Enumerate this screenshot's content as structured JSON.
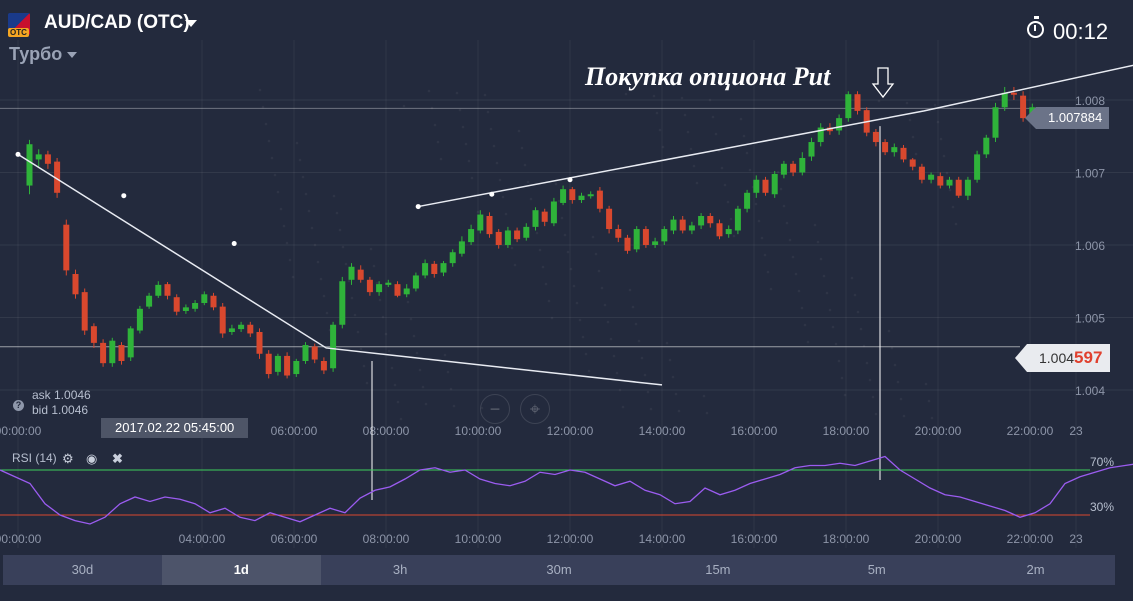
{
  "header": {
    "pair": "AUD/CAD (OTC)",
    "flag_badge": "OTC",
    "mode": "Турбо",
    "timer": "00:12"
  },
  "annotation": "Покупка опциона Put",
  "price_labels": {
    "current": "1.007884",
    "strike_prefix": "1.004",
    "strike_suffix": "597"
  },
  "quotes": {
    "ask": "ask 1.0046",
    "bid": "bid 1.0046",
    "help_icon": "?"
  },
  "crosshair_date": "2017.02.22 05:45:00",
  "rsi": {
    "label": "RSI (14)",
    "upper": "70%",
    "lower": "30%",
    "upper_level": 70,
    "lower_level": 30
  },
  "timeframes": [
    "30d",
    "1d",
    "3h",
    "30m",
    "15m",
    "5m",
    "2m"
  ],
  "active_timeframe": "1d",
  "colors": {
    "bg": "#232a3d",
    "up": "#2fb33a",
    "down": "#d9482e",
    "rsi_line": "#9b5cf0",
    "level70": "#3ccf5a",
    "level30": "#d9482e"
  },
  "chart_data": {
    "type": "candlestick",
    "y_ticks": [
      "1.008",
      "1.007",
      "1.006",
      "1.005",
      "1.004"
    ],
    "y_tick_values": [
      1.008,
      1.007,
      1.006,
      1.005,
      1.004
    ],
    "ylim": [
      1.00325,
      1.00855
    ],
    "x_ticks": [
      "00:00:00",
      "04:00:00",
      "06:00:00",
      "08:00:00",
      "10:00:00",
      "12:00:00",
      "14:00:00",
      "16:00:00",
      "18:00:00",
      "20:00:00",
      "22:00:00",
      "23"
    ],
    "x_tick_hours": [
      0,
      4,
      6,
      8,
      10,
      12,
      14,
      16,
      18,
      20,
      22,
      23
    ],
    "x_range_hours": [
      0,
      24.4
    ],
    "candles": [
      [
        0.25,
        1.00682,
        1.00739,
        1.0067,
        1.00745
      ],
      [
        0.45,
        1.00718,
        1.00725,
        1.00708,
        1.00732
      ],
      [
        0.65,
        1.00725,
        1.00712,
        1.00705,
        1.0073
      ],
      [
        0.85,
        1.00715,
        1.00672,
        1.00665,
        1.0072
      ],
      [
        1.05,
        1.00628,
        1.00565,
        1.00558,
        1.00635
      ],
      [
        1.25,
        1.0056,
        1.00532,
        1.00526,
        1.00566
      ],
      [
        1.45,
        1.00535,
        1.00482,
        1.00476,
        1.0054
      ],
      [
        1.65,
        1.00488,
        1.00465,
        1.00458,
        1.00492
      ],
      [
        1.85,
        1.00465,
        1.00437,
        1.00432,
        1.0047
      ],
      [
        2.05,
        1.00437,
        1.00468,
        1.00432,
        1.00472
      ],
      [
        2.25,
        1.00462,
        1.0044,
        1.00435,
        1.00466
      ],
      [
        2.45,
        1.00445,
        1.00485,
        1.0044,
        1.00488
      ],
      [
        2.65,
        1.00482,
        1.00512,
        1.00478,
        1.00516
      ],
      [
        2.85,
        1.00515,
        1.0053,
        1.00512,
        1.00534
      ],
      [
        3.05,
        1.0053,
        1.00545,
        1.00527,
        1.0055
      ],
      [
        3.25,
        1.00546,
        1.0053,
        1.00525,
        1.00549
      ],
      [
        3.45,
        1.00528,
        1.00508,
        1.00503,
        1.00532
      ],
      [
        3.65,
        1.00509,
        1.00514,
        1.00505,
        1.00518
      ],
      [
        3.85,
        1.00512,
        1.0052,
        1.00508,
        1.00524
      ],
      [
        4.05,
        1.0052,
        1.00532,
        1.00517,
        1.00536
      ],
      [
        4.25,
        1.0053,
        1.00514,
        1.0051,
        1.00534
      ],
      [
        4.45,
        1.00515,
        1.00478,
        1.00472,
        1.0052
      ],
      [
        4.65,
        1.0048,
        1.00485,
        1.00476,
        1.0049
      ],
      [
        4.85,
        1.00484,
        1.0049,
        1.0048,
        1.00494
      ],
      [
        5.05,
        1.0049,
        1.00478,
        1.00473,
        1.00494
      ],
      [
        5.25,
        1.0048,
        1.0045,
        1.00443,
        1.00485
      ],
      [
        5.45,
        1.0045,
        1.00422,
        1.00416,
        1.00455
      ],
      [
        5.65,
        1.00425,
        1.00447,
        1.0042,
        1.0045
      ],
      [
        5.85,
        1.00447,
        1.0042,
        1.00416,
        1.00452
      ],
      [
        6.05,
        1.00422,
        1.0044,
        1.00418,
        1.00443
      ],
      [
        6.25,
        1.0044,
        1.00462,
        1.00436,
        1.00466
      ],
      [
        6.45,
        1.0046,
        1.00442,
        1.00437,
        1.00464
      ],
      [
        6.65,
        1.0044,
        1.00427,
        1.00422,
        1.00445
      ],
      [
        6.85,
        1.0043,
        1.0049,
        1.00425,
        1.00494
      ],
      [
        7.05,
        1.0049,
        1.0055,
        1.00485,
        1.00556
      ],
      [
        7.25,
        1.00552,
        1.0057,
        1.00545,
        1.00575
      ],
      [
        7.45,
        1.00566,
        1.00552,
        1.00548,
        1.00572
      ],
      [
        7.65,
        1.00552,
        1.00535,
        1.0053,
        1.00556
      ],
      [
        7.85,
        1.00535,
        1.00546,
        1.0053,
        1.0055
      ],
      [
        8.05,
        1.00545,
        1.00548,
        1.00542,
        1.00552
      ],
      [
        8.25,
        1.00546,
        1.0053,
        1.00528,
        1.0055
      ],
      [
        8.45,
        1.00532,
        1.0054,
        1.00528,
        1.00546
      ],
      [
        8.65,
        1.0054,
        1.00558,
        1.00536,
        1.00562
      ],
      [
        8.85,
        1.00558,
        1.00575,
        1.00554,
        1.0058
      ],
      [
        9.05,
        1.00574,
        1.0056,
        1.00555,
        1.00578
      ],
      [
        9.25,
        1.00562,
        1.00575,
        1.00557,
        1.00578
      ],
      [
        9.45,
        1.00575,
        1.0059,
        1.0057,
        1.00594
      ],
      [
        9.65,
        1.00588,
        1.00605,
        1.00584,
        1.00612
      ],
      [
        9.85,
        1.00604,
        1.00622,
        1.006,
        1.00628
      ],
      [
        10.05,
        1.0062,
        1.00642,
        1.00616,
        1.00648
      ],
      [
        10.25,
        1.0064,
        1.00615,
        1.0061,
        1.00645
      ],
      [
        10.45,
        1.00618,
        1.006,
        1.00595,
        1.00622
      ],
      [
        10.65,
        1.006,
        1.0062,
        1.00596,
        1.00625
      ],
      [
        10.85,
        1.0062,
        1.00608,
        1.00604,
        1.00624
      ],
      [
        11.05,
        1.0061,
        1.00625,
        1.00606,
        1.0063
      ],
      [
        11.25,
        1.00625,
        1.00648,
        1.0062,
        1.00652
      ],
      [
        11.45,
        1.00646,
        1.00632,
        1.00626,
        1.0065
      ],
      [
        11.65,
        1.0063,
        1.0066,
        1.00626,
        1.00665
      ],
      [
        11.85,
        1.00658,
        1.00677,
        1.00655,
        1.00682
      ],
      [
        12.05,
        1.00677,
        1.00662,
        1.00657,
        1.0068
      ],
      [
        12.25,
        1.00662,
        1.00668,
        1.00658,
        1.00672
      ],
      [
        12.45,
        1.00668,
        1.0067,
        1.00664,
        1.00674
      ],
      [
        12.65,
        1.00675,
        1.0065,
        1.00645,
        1.0068
      ],
      [
        12.85,
        1.0065,
        1.00622,
        1.00616,
        1.00654
      ],
      [
        13.05,
        1.00622,
        1.0061,
        1.00604,
        1.00628
      ],
      [
        13.25,
        1.0061,
        1.00592,
        1.00588,
        1.00614
      ],
      [
        13.45,
        1.00594,
        1.00622,
        1.0059,
        1.00626
      ],
      [
        13.65,
        1.00622,
        1.006,
        1.00596,
        1.00626
      ],
      [
        13.85,
        1.006,
        1.00605,
        1.00596,
        1.0061
      ],
      [
        14.05,
        1.00605,
        1.00622,
        1.006,
        1.00626
      ],
      [
        14.25,
        1.0062,
        1.00635,
        1.00615,
        1.0064
      ],
      [
        14.45,
        1.00635,
        1.0062,
        1.00616,
        1.0064
      ],
      [
        14.65,
        1.0062,
        1.00627,
        1.00615,
        1.00632
      ],
      [
        14.85,
        1.00627,
        1.0064,
        1.00622,
        1.00644
      ],
      [
        15.05,
        1.0064,
        1.0063,
        1.00624,
        1.00644
      ],
      [
        15.25,
        1.0063,
        1.00612,
        1.00608,
        1.00635
      ],
      [
        15.45,
        1.00615,
        1.00622,
        1.0061,
        1.00627
      ],
      [
        15.65,
        1.0062,
        1.0065,
        1.00615,
        1.00654
      ],
      [
        15.85,
        1.0065,
        1.00672,
        1.00645,
        1.00676
      ],
      [
        16.05,
        1.00672,
        1.0069,
        1.00665,
        1.00696
      ],
      [
        16.25,
        1.0069,
        1.00672,
        1.00668,
        1.00694
      ],
      [
        16.45,
        1.0067,
        1.00698,
        1.00665,
        1.00702
      ],
      [
        16.65,
        1.00697,
        1.00712,
        1.00692,
        1.00716
      ],
      [
        16.85,
        1.00712,
        1.007,
        1.00695,
        1.00716
      ],
      [
        17.05,
        1.007,
        1.0072,
        1.00696,
        1.00728
      ],
      [
        17.25,
        1.00722,
        1.00742,
        1.00716,
        1.00748
      ],
      [
        17.45,
        1.00742,
        1.00762,
        1.00736,
        1.00768
      ],
      [
        17.65,
        1.00762,
        1.00757,
        1.00752,
        1.00768
      ],
      [
        17.85,
        1.00758,
        1.00775,
        1.00752,
        1.0078
      ],
      [
        18.05,
        1.00775,
        1.00808,
        1.0077,
        1.00812
      ],
      [
        18.25,
        1.00808,
        1.00785,
        1.0078,
        1.00812
      ],
      [
        18.45,
        1.00786,
        1.00755,
        1.0075,
        1.0079
      ],
      [
        18.65,
        1.00756,
        1.00742,
        1.00736,
        1.0076
      ],
      [
        18.85,
        1.00742,
        1.00728,
        1.00724,
        1.00746
      ],
      [
        19.05,
        1.00728,
        1.00735,
        1.00722,
        1.0074
      ],
      [
        19.25,
        1.00734,
        1.00718,
        1.00714,
        1.00738
      ],
      [
        19.45,
        1.00718,
        1.00708,
        1.00703,
        1.0072
      ],
      [
        19.65,
        1.00708,
        1.0069,
        1.00685,
        1.00712
      ],
      [
        19.85,
        1.0069,
        1.00697,
        1.00685,
        1.007
      ],
      [
        20.05,
        1.00695,
        1.00682,
        1.00678,
        1.007
      ],
      [
        20.25,
        1.00682,
        1.0069,
        1.00678,
        1.00694
      ],
      [
        20.45,
        1.0069,
        1.00668,
        1.00665,
        1.00694
      ],
      [
        20.65,
        1.00668,
        1.0069,
        1.00662,
        1.00694
      ],
      [
        20.85,
        1.0069,
        1.00725,
        1.00686,
        1.0073
      ],
      [
        21.05,
        1.00725,
        1.00748,
        1.0072,
        1.00752
      ],
      [
        21.25,
        1.00748,
        1.0079,
        1.00742,
        1.00796
      ],
      [
        21.45,
        1.0079,
        1.0081,
        1.00785,
        1.00818
      ],
      [
        21.65,
        1.0081,
        1.00808,
        1.008,
        1.00818
      ],
      [
        21.85,
        1.00806,
        1.00775,
        1.0077,
        1.00812
      ],
      [
        22.05,
        1.00775,
        1.0079,
        1.00768,
        1.00795
      ]
    ]
  }
}
